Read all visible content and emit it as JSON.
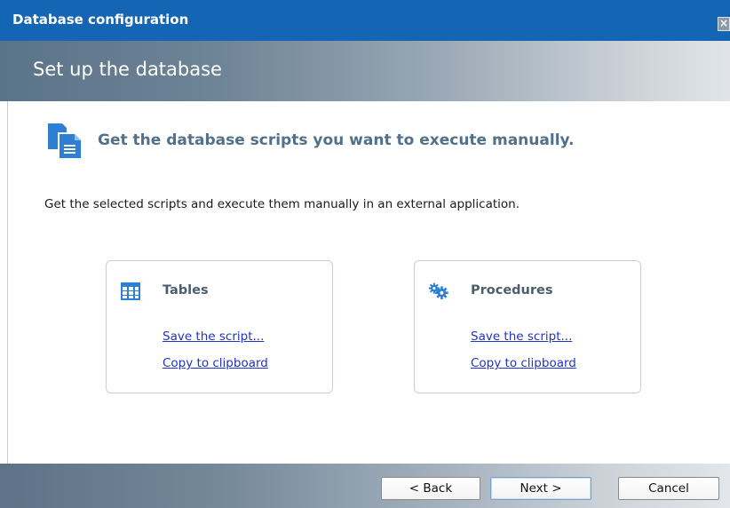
{
  "window": {
    "title": "Database configuration",
    "close_icon": "close-icon"
  },
  "header": {
    "heading": "Set up the database"
  },
  "intro": {
    "icon": "documents-icon",
    "title": "Get the database scripts you want to execute manually.",
    "description": "Get the selected scripts and execute them manually in an external application."
  },
  "cards": [
    {
      "icon": "table-icon",
      "title": "Tables",
      "save_link": "Save the script...",
      "copy_link": "Copy to clipboard"
    },
    {
      "icon": "gears-icon",
      "title": "Procedures",
      "save_link": "Save the script...",
      "copy_link": "Copy to clipboard"
    }
  ],
  "footer": {
    "back_label": "< Back",
    "next_label": "Next >",
    "cancel_label": "Cancel"
  },
  "colors": {
    "titlebar": "#1565b5",
    "accent_text": "#51708c",
    "link": "#1f34c9",
    "icon_blue": "#2d7fd4"
  }
}
